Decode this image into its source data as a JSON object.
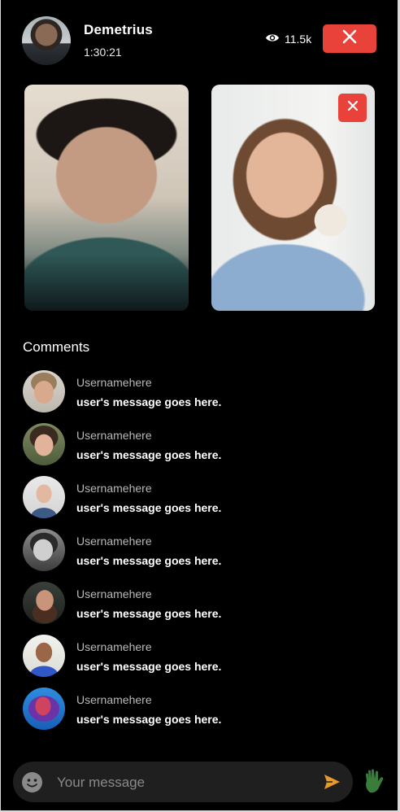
{
  "header": {
    "host_name": "Demetrius",
    "timer": "1:30:21",
    "viewer_count": "11.5k",
    "end_icon": "close-icon",
    "views_icon": "eye-icon"
  },
  "tiles": [
    {
      "name": "participant-video-1"
    },
    {
      "name": "participant-video-2",
      "close_icon": "close-icon"
    }
  ],
  "comments": {
    "title": "Comments",
    "items": [
      {
        "username": "Usernamehere",
        "message": "user's message goes here."
      },
      {
        "username": "Usernamehere",
        "message": "user's message goes here."
      },
      {
        "username": "Usernamehere",
        "message": "user's message goes here."
      },
      {
        "username": "Usernamehere",
        "message": "user's message goes here."
      },
      {
        "username": "Usernamehere",
        "message": "user's message goes here."
      },
      {
        "username": "Usernamehere",
        "message": "user's message goes here."
      },
      {
        "username": "Usernamehere",
        "message": "user's message goes here."
      }
    ]
  },
  "composer": {
    "placeholder": "Your message",
    "value": "",
    "emoji_icon": "emoji-icon",
    "send_icon": "send-icon",
    "wave_icon": "wave-hand-icon"
  },
  "colors": {
    "background": "#000000",
    "accent_red": "#e8423a",
    "send_orange": "#e89a2a",
    "wave_green": "#3a7d3a"
  }
}
